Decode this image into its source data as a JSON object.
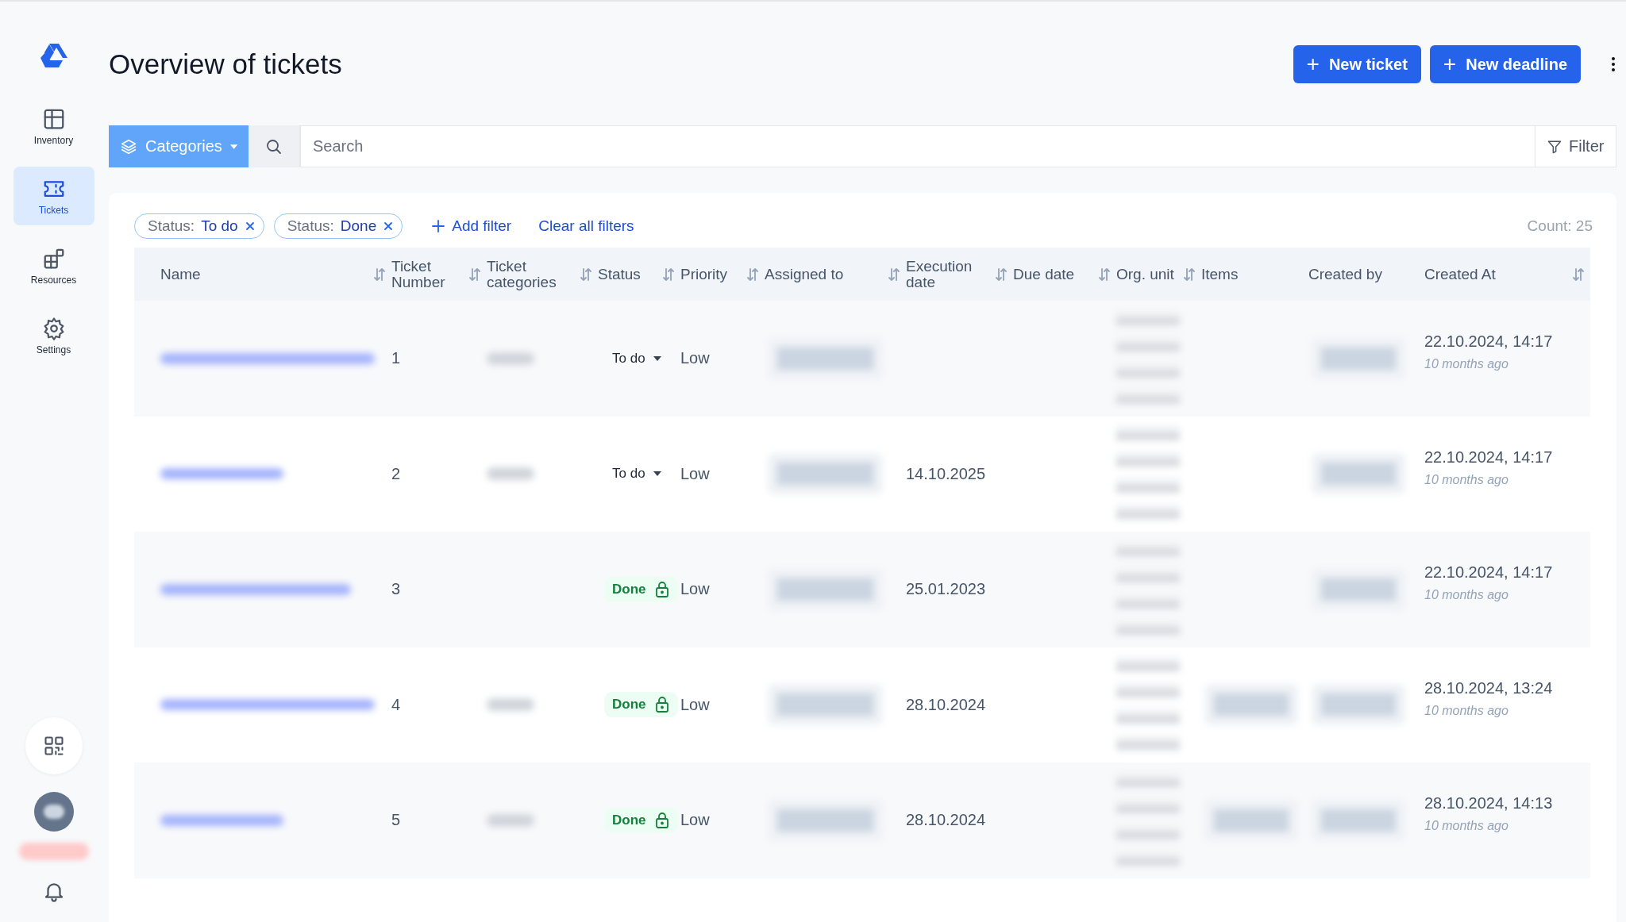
{
  "sidebar": {
    "items": [
      {
        "label": "Inventory",
        "selected": false
      },
      {
        "label": "Tickets",
        "selected": true
      },
      {
        "label": "Resources",
        "selected": false
      },
      {
        "label": "Settings",
        "selected": false
      }
    ]
  },
  "page": {
    "title": "Overview of tickets",
    "buttons": [
      {
        "label": "New ticket",
        "icon": "+"
      },
      {
        "label": "New deadline",
        "icon": "+"
      }
    ]
  },
  "searchbar": {
    "category_button": "Categories",
    "placeholder": "Search",
    "filter_button": "Filter"
  },
  "filters": {
    "chips": [
      {
        "key": "Status:",
        "value": "To do"
      },
      {
        "key": "Status:",
        "value": "Done"
      }
    ],
    "add_filter": "Add filter",
    "clear": "Clear all filters",
    "count": "Count: 25"
  },
  "table": {
    "columns": [
      {
        "label": "Name",
        "sortable": true
      },
      {
        "label": "Ticket Number",
        "sortable": true
      },
      {
        "label": "Ticket categories",
        "sortable": true
      },
      {
        "label": "Status",
        "sortable": true
      },
      {
        "label": "Priority",
        "sortable": true
      },
      {
        "label": "Assigned to",
        "sortable": true
      },
      {
        "label": "Execution date",
        "sortable": true
      },
      {
        "label": "Due date",
        "sortable": true
      },
      {
        "label": "Org. unit",
        "sortable": true
      },
      {
        "label": "Items",
        "sortable": false
      },
      {
        "label": "Created by",
        "sortable": false
      },
      {
        "label": "Created At",
        "sortable": true
      }
    ],
    "rows": [
      {
        "number": "1",
        "category_blurred": true,
        "status": {
          "kind": "todo",
          "label": "To do"
        },
        "priority": "Low",
        "items_blurred": false,
        "created_at": "22.10.2024, 14:17",
        "created_ago": "10 months ago"
      },
      {
        "number": "2",
        "category_blurred": true,
        "status": {
          "kind": "todo",
          "label": "To do"
        },
        "priority": "Low",
        "execution_date": "14.10.2025",
        "items_blurred": false,
        "created_at": "22.10.2024, 14:17",
        "created_ago": "10 months ago"
      },
      {
        "number": "3",
        "category_blurred": false,
        "status": {
          "kind": "done",
          "label": "Done"
        },
        "priority": "Low",
        "execution_date": "25.01.2023",
        "items_blurred": false,
        "created_at": "22.10.2024, 14:17",
        "created_ago": "10 months ago"
      },
      {
        "number": "4",
        "category_blurred": true,
        "status": {
          "kind": "done",
          "label": "Done"
        },
        "priority": "Low",
        "execution_date": "28.10.2024",
        "items_blurred": true,
        "created_at": "28.10.2024, 13:24",
        "created_ago": "10 months ago"
      },
      {
        "number": "5",
        "category_blurred": true,
        "status": {
          "kind": "done",
          "label": "Done"
        },
        "priority": "Low",
        "execution_date": "28.10.2024",
        "items_blurred": true,
        "created_at": "28.10.2024, 14:13",
        "created_ago": "10 months ago"
      }
    ]
  }
}
